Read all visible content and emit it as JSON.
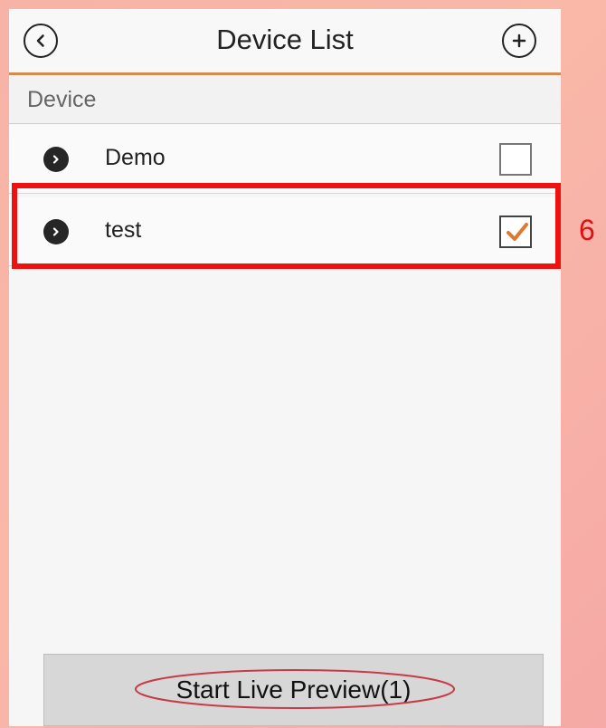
{
  "header": {
    "title": "Device List",
    "back_icon": "chevron-left-icon",
    "add_icon": "plus-icon"
  },
  "section": {
    "label": "Device"
  },
  "devices": [
    {
      "name": "Demo",
      "checked": false,
      "icon": "chevron-right-icon"
    },
    {
      "name": "test",
      "checked": true,
      "icon": "chevron-right-icon"
    }
  ],
  "annotations": {
    "highlight_number": "6",
    "highlight_color": "#ef1010",
    "ellipse_color": "#c63b46"
  },
  "footer": {
    "button_label": "Start Live Preview(1)"
  },
  "colors": {
    "header_accent": "#d58b4f",
    "checkmark": "#e0782e"
  }
}
